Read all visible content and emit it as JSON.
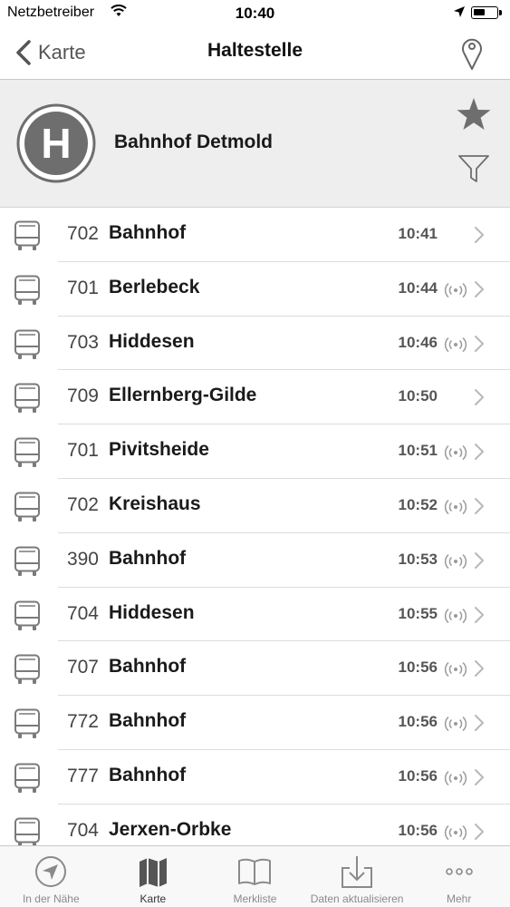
{
  "status_bar": {
    "carrier": "Netzbetreiber",
    "time": "10:40",
    "icons": [
      "wifi-icon",
      "location-arrow-icon",
      "battery-icon"
    ]
  },
  "nav": {
    "back_label": "Karte",
    "title": "Haltestelle",
    "icons": [
      "back-chevron-icon",
      "map-pin-icon"
    ]
  },
  "stop": {
    "name": "Bahnhof Detmold",
    "logo_letter": "H",
    "icons": [
      "bus-stop-logo",
      "star-icon",
      "filter-icon"
    ]
  },
  "departures": [
    {
      "line": "702",
      "destination": "Bahnhof",
      "time": "10:41",
      "realtime": false
    },
    {
      "line": "701",
      "destination": "Berlebeck",
      "time": "10:44",
      "realtime": true
    },
    {
      "line": "703",
      "destination": "Hiddesen",
      "time": "10:46",
      "realtime": true
    },
    {
      "line": "709",
      "destination": "Ellernberg-Gilde",
      "time": "10:50",
      "realtime": false
    },
    {
      "line": "701",
      "destination": "Pivitsheide",
      "time": "10:51",
      "realtime": true
    },
    {
      "line": "702",
      "destination": "Kreishaus",
      "time": "10:52",
      "realtime": true
    },
    {
      "line": "390",
      "destination": "Bahnhof",
      "time": "10:53",
      "realtime": true
    },
    {
      "line": "704",
      "destination": "Hiddesen",
      "time": "10:55",
      "realtime": true
    },
    {
      "line": "707",
      "destination": "Bahnhof",
      "time": "10:56",
      "realtime": true
    },
    {
      "line": "772",
      "destination": "Bahnhof",
      "time": "10:56",
      "realtime": true
    },
    {
      "line": "777",
      "destination": "Bahnhof",
      "time": "10:56",
      "realtime": true
    },
    {
      "line": "704",
      "destination": "Jerxen-Orbke",
      "time": "10:56",
      "realtime": true
    }
  ],
  "tabs": [
    {
      "label": "In der Nähe",
      "icon": "location-compass-icon",
      "active": false
    },
    {
      "label": "Karte",
      "icon": "map-icon",
      "active": true
    },
    {
      "label": "Merkliste",
      "icon": "book-icon",
      "active": false
    },
    {
      "label": "Daten aktualisieren",
      "icon": "download-icon",
      "active": false
    },
    {
      "label": "Mehr",
      "icon": "more-dots-icon",
      "active": false
    }
  ],
  "colors": {
    "header_bg": "#eeeeee",
    "text_dark": "#1a1a1a",
    "icon_gray": "#7a7a7a",
    "tab_active": "#333333"
  }
}
